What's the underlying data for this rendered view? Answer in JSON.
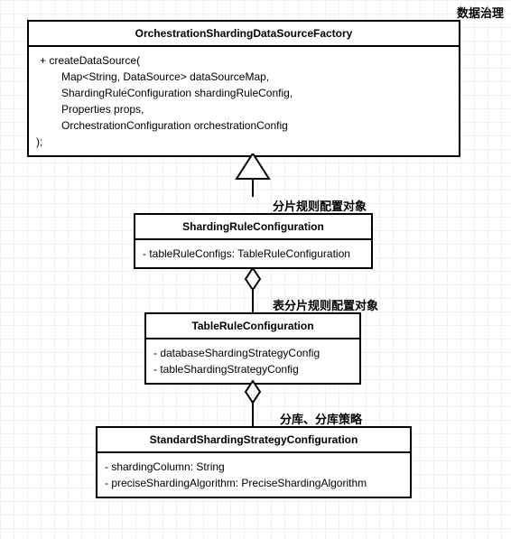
{
  "annotations": {
    "top": "数据治理",
    "mid1": "分片规则配置对象",
    "mid2": "表分片规则配置对象",
    "mid3": "分库、分库策略"
  },
  "box1": {
    "title": "OrchestrationShardingDataSourceFactory",
    "method_open": "+  createDataSource(",
    "param1": "Map<String, DataSource> dataSourceMap,",
    "param2": "ShardingRuleConfiguration shardingRuleConfig,",
    "param3": "Properties props,",
    "param4": "OrchestrationConfiguration orchestrationConfig",
    "method_close": ");"
  },
  "box2": {
    "title": "ShardingRuleConfiguration",
    "attr1": "-   tableRuleConfigs:  TableRuleConfiguration"
  },
  "box3": {
    "title": "TableRuleConfiguration",
    "attr1": "-   databaseShardingStrategyConfig",
    "attr2": "-   tableShardingStrategyConfig"
  },
  "box4": {
    "title": "StandardShardingStrategyConfiguration",
    "attr1": "-   shardingColumn: String",
    "attr2": "-   preciseShardingAlgorithm: PreciseShardingAlgorithm"
  },
  "chart_data": {
    "type": "diagram",
    "diagram_type": "uml_class",
    "classes": [
      {
        "name": "OrchestrationShardingDataSourceFactory",
        "annotation": "数据治理",
        "methods": [
          {
            "visibility": "+",
            "name": "createDataSource",
            "params": [
              "Map<String, DataSource> dataSourceMap",
              "ShardingRuleConfiguration shardingRuleConfig",
              "Properties props",
              "OrchestrationConfiguration orchestrationConfig"
            ]
          }
        ]
      },
      {
        "name": "ShardingRuleConfiguration",
        "annotation": "分片规则配置对象",
        "attributes": [
          {
            "visibility": "-",
            "name": "tableRuleConfigs",
            "type": "TableRuleConfiguration"
          }
        ]
      },
      {
        "name": "TableRuleConfiguration",
        "annotation": "表分片规则配置对象",
        "attributes": [
          {
            "visibility": "-",
            "name": "databaseShardingStrategyConfig"
          },
          {
            "visibility": "-",
            "name": "tableShardingStrategyConfig"
          }
        ]
      },
      {
        "name": "StandardShardingStrategyConfiguration",
        "annotation": "分库、分库策略",
        "attributes": [
          {
            "visibility": "-",
            "name": "shardingColumn",
            "type": "String"
          },
          {
            "visibility": "-",
            "name": "preciseShardingAlgorithm",
            "type": "PreciseShardingAlgorithm"
          }
        ]
      }
    ],
    "relationships": [
      {
        "from": "ShardingRuleConfiguration",
        "to": "OrchestrationShardingDataSourceFactory",
        "type": "realization_hollow_arrow"
      },
      {
        "from": "TableRuleConfiguration",
        "to": "ShardingRuleConfiguration",
        "type": "aggregation"
      },
      {
        "from": "StandardShardingStrategyConfiguration",
        "to": "TableRuleConfiguration",
        "type": "aggregation"
      }
    ]
  }
}
